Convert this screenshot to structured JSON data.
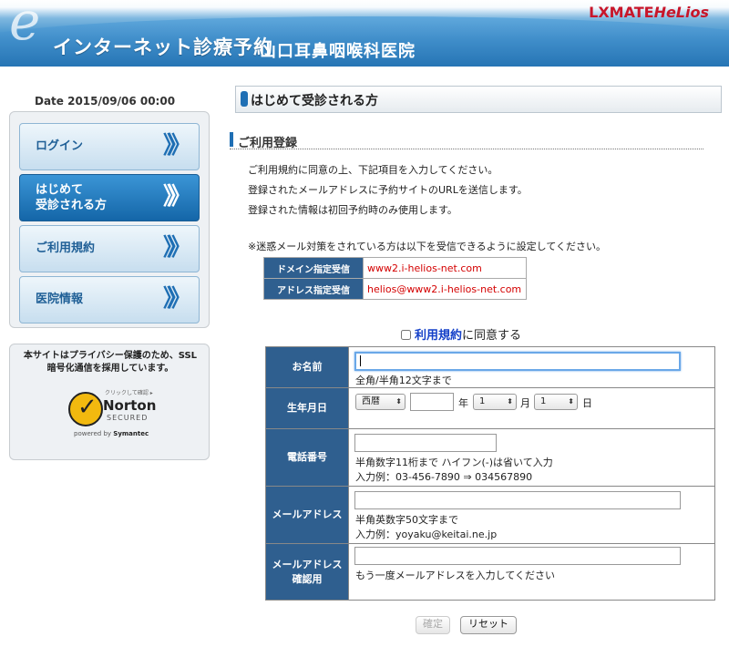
{
  "header": {
    "app_title": "インターネット診療予約",
    "clinic_name": "山口耳鼻咽喉科医院",
    "brand_main": "LXMATE",
    "brand_sub": "HeLios"
  },
  "sidebar": {
    "date": "Date 2015/09/06 00:00",
    "items": [
      {
        "label": "ログイン",
        "arrows": "》》"
      },
      {
        "label_line1": "はじめて",
        "label_line2": "受診される方",
        "arrows": "》》"
      },
      {
        "label": "ご利用規約",
        "arrows": "》》"
      },
      {
        "label": "医院情報",
        "arrows": "》》"
      }
    ],
    "security_text": "本サイトはプライバシー保護のため、SSL暗号化通信を採用しています。",
    "norton": {
      "small": "クリックして確認 ▸",
      "name": "Norton",
      "secured": "SECURED",
      "powered": "powered by",
      "symantec": "Symantec"
    }
  },
  "main": {
    "page_title": "はじめて受診される方",
    "section_title": "ご利用登録",
    "paragraphs": [
      "ご利用規約に同意の上、下記項目を入力してください。",
      "登録されたメールアドレスに予約サイトのURLを送信します。",
      "登録された情報は初回予約時のみ使用します。"
    ],
    "spam_note": "※迷惑メール対策をされている方は以下を受信できるように設定してください。",
    "spam_table": [
      {
        "label": "ドメイン指定受信",
        "value": "www2.i-helios-net.com"
      },
      {
        "label": "アドレス指定受信",
        "value": "helios@www2.i-helios-net.com"
      }
    ],
    "agree_link": "利用規約",
    "agree_text": "に同意する",
    "agree_checked": false
  },
  "form": {
    "name": {
      "label": "お名前",
      "value": "",
      "hint": "全角/半角12文字まで"
    },
    "birthday": {
      "label": "生年月日",
      "era": "西暦",
      "year": "",
      "year_unit": "年",
      "month": "1",
      "month_unit": "月",
      "day": "1",
      "day_unit": "日"
    },
    "phone": {
      "label": "電話番号",
      "value": "",
      "hint1": "半角数字11桁まで ハイフン(-)は省いて入力",
      "hint2": "入力例：03-456-7890 ⇒ 034567890"
    },
    "email": {
      "label": "メールアドレス",
      "value": "",
      "hint1": "半角英数字50文字まで",
      "hint2": "入力例：yoyaku@keitai.ne.jp"
    },
    "email_confirm": {
      "label_line1": "メールアドレス",
      "label_line2": "確認用",
      "value": "",
      "hint": "もう一度メールアドレスを入力してください"
    }
  },
  "buttons": {
    "confirm": "確定",
    "reset": "リセット"
  },
  "colors": {
    "accent": "#1f6fb4",
    "table_header": "#2f5f8f",
    "brand": "#c8162a",
    "link": "#1440c8",
    "warning": "#d40000"
  }
}
